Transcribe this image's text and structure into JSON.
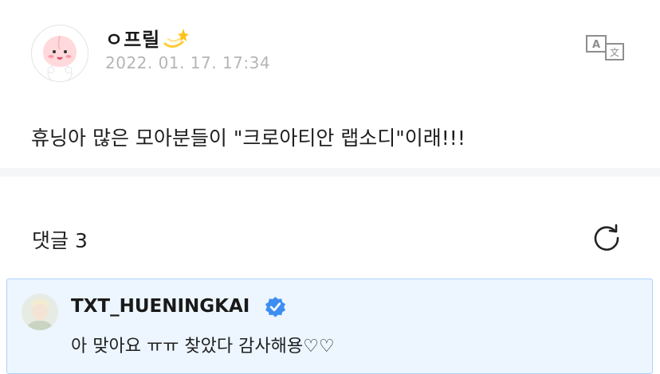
{
  "post": {
    "author": {
      "name": "ㅇ프릴",
      "emoji": "💫",
      "avatar_icon": "apeach-avatar-icon"
    },
    "date": "2022. 01. 17. 17:34",
    "translate_icon": "translate-icon",
    "body": "휴닝아 많은 모아분들이 \"크로아티안 랩소디\"이래!!!"
  },
  "comments": {
    "header": "댓글 3",
    "refresh_icon": "refresh-icon",
    "items": [
      {
        "author": "TXT_HUENINGKAI",
        "verified_icon": "verified-badge-icon",
        "text": "아 맞아요 ㅠㅠ 찾았다 감사해용♡♡",
        "highlight_color": "#edf6ff",
        "border_color": "#a9d3ff"
      }
    ]
  }
}
